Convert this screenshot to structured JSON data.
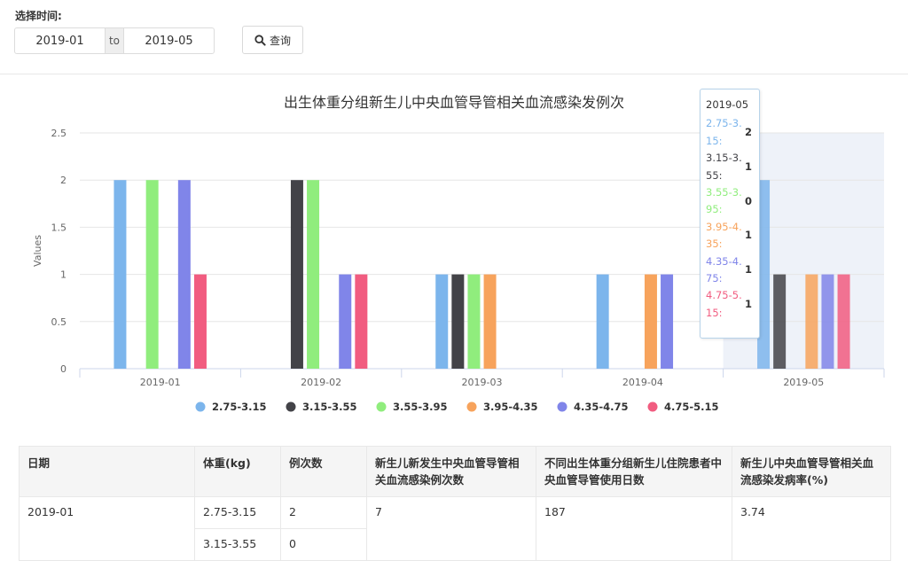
{
  "filter": {
    "label": "选择时间:",
    "start": "2019-01",
    "to": "to",
    "end": "2019-05",
    "query_label": "查询"
  },
  "chart_data": {
    "type": "bar",
    "title": "出生体重分组新生儿中央血管导管相关血流感染发例次",
    "xlabel": "",
    "ylabel": "Values",
    "ylim": [
      0,
      2.5
    ],
    "yticks": [
      "0",
      "0.5",
      "1",
      "1.5",
      "2",
      "2.5"
    ],
    "categories": [
      "2019-01",
      "2019-02",
      "2019-03",
      "2019-04",
      "2019-05"
    ],
    "series": [
      {
        "name": "2.75-3.15",
        "color": "#7cb5ec",
        "values": [
          2,
          0,
          1,
          1,
          2
        ]
      },
      {
        "name": "3.15-3.55",
        "color": "#434348",
        "values": [
          0,
          2,
          1,
          0,
          1
        ]
      },
      {
        "name": "3.55-3.95",
        "color": "#90ed7d",
        "values": [
          2,
          2,
          1,
          0,
          0
        ]
      },
      {
        "name": "3.95-4.35",
        "color": "#f7a35c",
        "values": [
          0,
          0,
          1,
          1,
          1
        ]
      },
      {
        "name": "4.35-4.75",
        "color": "#8085e9",
        "values": [
          2,
          1,
          0,
          1,
          1
        ]
      },
      {
        "name": "4.75-5.15",
        "color": "#f15c80",
        "values": [
          1,
          1,
          0,
          0,
          1
        ]
      }
    ],
    "highlight_category": "2019-05",
    "grid": true,
    "legend_position": "bottom"
  },
  "tooltip": {
    "title": "2019-05",
    "rows": [
      {
        "name": "2.75-3.15:",
        "value": "2",
        "color": "#7cb5ec"
      },
      {
        "name": "3.15-3.55:",
        "value": "1",
        "color": "#434348"
      },
      {
        "name": "3.55-3.95:",
        "value": "0",
        "color": "#90ed7d"
      },
      {
        "name": "3.95-4.35:",
        "value": "1",
        "color": "#f7a35c"
      },
      {
        "name": "4.35-4.75:",
        "value": "1",
        "color": "#8085e9"
      },
      {
        "name": "4.75-5.15:",
        "value": "1",
        "color": "#f15c80"
      }
    ]
  },
  "table": {
    "headers": [
      "日期",
      "体重(kg)",
      "例次数",
      "新生儿新发生中央血管导管相关血流感染例次数",
      "不同出生体重分组新生儿住院患者中央血管导管使用日数",
      "新生儿中央血管导管相关血流感染发病率(%)"
    ],
    "rows": [
      {
        "date": "2019-01",
        "weight": "2.75-3.15",
        "count": "2",
        "new": "7",
        "days": "187",
        "rate": "3.74"
      },
      {
        "weight": "3.15-3.55",
        "count": "0"
      }
    ]
  }
}
